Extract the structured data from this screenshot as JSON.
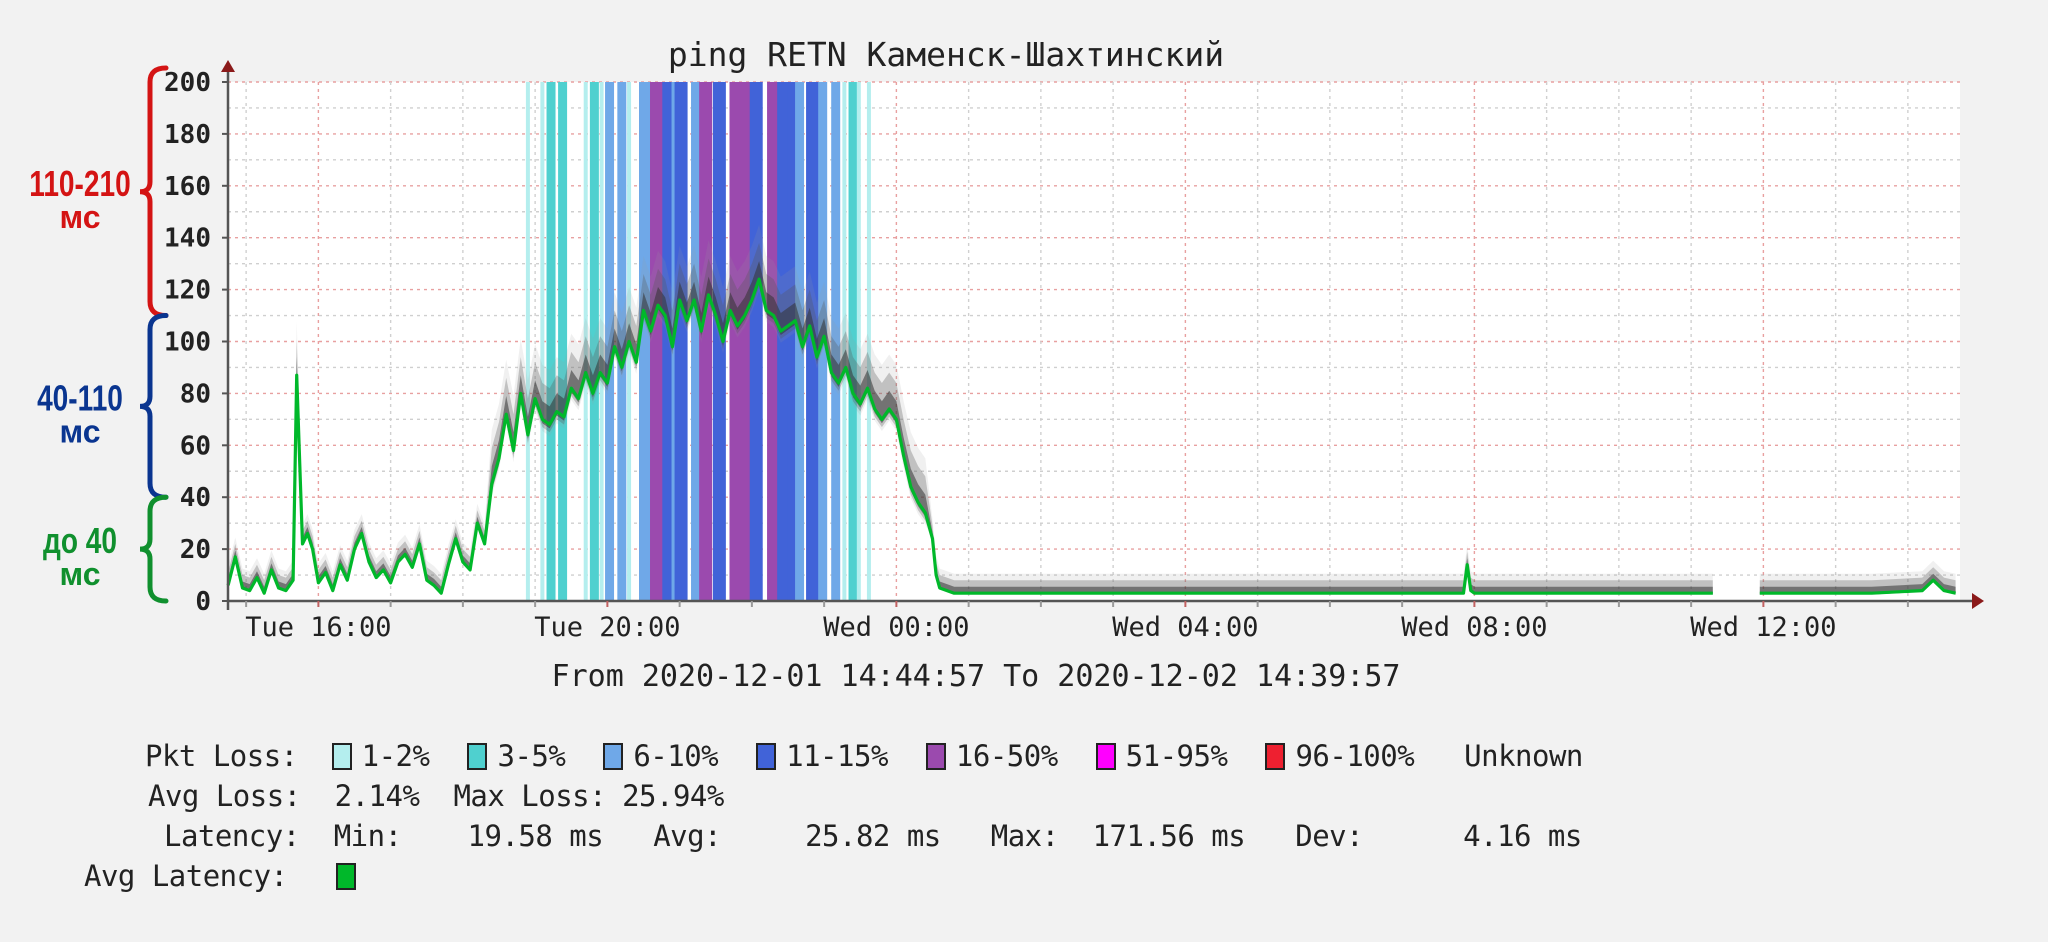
{
  "chart_data": {
    "type": "line",
    "title": "ping RETN Каменск-Шахтинский",
    "subtitle": "From 2020-12-01 14:44:57 To 2020-12-02 14:39:57",
    "xlabel": "",
    "ylabel": "",
    "ylim": [
      0,
      200
    ],
    "y_ticks": [
      "0",
      "20",
      "40",
      "60",
      "80",
      "100",
      "120",
      "140",
      "160",
      "180",
      "200"
    ],
    "x_range_hours": [
      14.749,
      38.666
    ],
    "x_ticks": [
      {
        "label": "Tue 16:00",
        "hour": 16
      },
      {
        "label": "Tue 20:00",
        "hour": 20
      },
      {
        "label": "Wed 00:00",
        "hour": 24
      },
      {
        "label": "Wed 04:00",
        "hour": 28
      },
      {
        "label": "Wed 08:00",
        "hour": 32
      },
      {
        "label": "Wed 12:00",
        "hour": 36
      }
    ],
    "grid": true,
    "series": [
      {
        "name": "Avg Latency",
        "color": "#00b82a",
        "unit": "ms",
        "points": [
          [
            14.75,
            6
          ],
          [
            14.85,
            17
          ],
          [
            14.95,
            5
          ],
          [
            15.05,
            4
          ],
          [
            15.15,
            9
          ],
          [
            15.25,
            3
          ],
          [
            15.35,
            12
          ],
          [
            15.45,
            5
          ],
          [
            15.55,
            4
          ],
          [
            15.65,
            8
          ],
          [
            15.7,
            87
          ],
          [
            15.78,
            22
          ],
          [
            15.85,
            26
          ],
          [
            15.92,
            20
          ],
          [
            16.0,
            7
          ],
          [
            16.1,
            11
          ],
          [
            16.2,
            4
          ],
          [
            16.3,
            14
          ],
          [
            16.4,
            8
          ],
          [
            16.5,
            20
          ],
          [
            16.6,
            26
          ],
          [
            16.7,
            15
          ],
          [
            16.8,
            9
          ],
          [
            16.9,
            12
          ],
          [
            17.0,
            7
          ],
          [
            17.1,
            15
          ],
          [
            17.2,
            18
          ],
          [
            17.3,
            13
          ],
          [
            17.4,
            22
          ],
          [
            17.5,
            8
          ],
          [
            17.6,
            6
          ],
          [
            17.7,
            3
          ],
          [
            17.8,
            14
          ],
          [
            17.9,
            24
          ],
          [
            18.0,
            15
          ],
          [
            18.1,
            12
          ],
          [
            18.2,
            30
          ],
          [
            18.3,
            22
          ],
          [
            18.4,
            45
          ],
          [
            18.5,
            55
          ],
          [
            18.6,
            72
          ],
          [
            18.7,
            58
          ],
          [
            18.8,
            80
          ],
          [
            18.9,
            64
          ],
          [
            19.0,
            78
          ],
          [
            19.1,
            70
          ],
          [
            19.2,
            68
          ],
          [
            19.3,
            73
          ],
          [
            19.4,
            71
          ],
          [
            19.5,
            82
          ],
          [
            19.6,
            78
          ],
          [
            19.7,
            88
          ],
          [
            19.8,
            80
          ],
          [
            19.9,
            88
          ],
          [
            20.0,
            84
          ],
          [
            20.1,
            98
          ],
          [
            20.2,
            90
          ],
          [
            20.3,
            100
          ],
          [
            20.4,
            92
          ],
          [
            20.5,
            112
          ],
          [
            20.6,
            104
          ],
          [
            20.7,
            114
          ],
          [
            20.8,
            110
          ],
          [
            20.9,
            98
          ],
          [
            21.0,
            116
          ],
          [
            21.1,
            108
          ],
          [
            21.2,
            116
          ],
          [
            21.3,
            104
          ],
          [
            21.4,
            118
          ],
          [
            21.5,
            110
          ],
          [
            21.6,
            100
          ],
          [
            21.7,
            112
          ],
          [
            21.8,
            106
          ],
          [
            21.9,
            110
          ],
          [
            22.0,
            116
          ],
          [
            22.1,
            124
          ],
          [
            22.2,
            112
          ],
          [
            22.3,
            110
          ],
          [
            22.4,
            104
          ],
          [
            22.5,
            106
          ],
          [
            22.6,
            108
          ],
          [
            22.7,
            98
          ],
          [
            22.8,
            106
          ],
          [
            22.9,
            94
          ],
          [
            23.0,
            102
          ],
          [
            23.1,
            88
          ],
          [
            23.2,
            84
          ],
          [
            23.3,
            90
          ],
          [
            23.4,
            80
          ],
          [
            23.5,
            76
          ],
          [
            23.6,
            82
          ],
          [
            23.7,
            74
          ],
          [
            23.8,
            70
          ],
          [
            23.9,
            74
          ],
          [
            24.0,
            70
          ],
          [
            24.1,
            56
          ],
          [
            24.2,
            44
          ],
          [
            24.3,
            38
          ],
          [
            24.4,
            34
          ],
          [
            24.5,
            24
          ],
          [
            24.55,
            10
          ],
          [
            24.6,
            5
          ],
          [
            24.8,
            3
          ],
          [
            25,
            3
          ],
          [
            26,
            3
          ],
          [
            27,
            3
          ],
          [
            28,
            3
          ],
          [
            29,
            3
          ],
          [
            30,
            3
          ],
          [
            31,
            3
          ],
          [
            31.85,
            3
          ],
          [
            31.9,
            14
          ],
          [
            31.95,
            4
          ],
          [
            32,
            3
          ],
          [
            33,
            3
          ],
          [
            34,
            3
          ],
          [
            35,
            3
          ],
          [
            35.3,
            3
          ],
          [
            35.95,
            3
          ],
          [
            36.4,
            3
          ],
          [
            37,
            3
          ],
          [
            37.5,
            3
          ],
          [
            38.2,
            4
          ],
          [
            38.35,
            8
          ],
          [
            38.5,
            4
          ],
          [
            38.66,
            3
          ]
        ],
        "gaps": [
          [
            35.3,
            35.95
          ]
        ]
      }
    ],
    "loss_bands": [
      {
        "hour": 18.9,
        "range": "1-2%"
      },
      {
        "hour": 19.1,
        "range": "1-2%"
      },
      {
        "hour": 19.22,
        "range": "3-5%"
      },
      {
        "hour": 19.38,
        "range": "3-5%"
      },
      {
        "hour": 19.7,
        "range": "1-2%"
      },
      {
        "hour": 19.82,
        "range": "3-5%"
      },
      {
        "hour": 19.92,
        "range": "1-2%"
      },
      {
        "hour": 20.03,
        "range": "6-10%"
      },
      {
        "hour": 20.2,
        "range": "6-10%"
      },
      {
        "hour": 20.3,
        "range": "1-2%"
      },
      {
        "hour": 20.5,
        "range": "6-10%"
      },
      {
        "hour": 20.58,
        "range": "6-10%"
      },
      {
        "hour": 20.68,
        "range": "16-50%"
      },
      {
        "hour": 20.85,
        "range": "11-15%"
      },
      {
        "hour": 20.95,
        "range": "6-10%"
      },
      {
        "hour": 21.02,
        "range": "11-15%"
      },
      {
        "hour": 21.22,
        "range": "6-10%"
      },
      {
        "hour": 21.36,
        "range": "16-50%"
      },
      {
        "hour": 21.55,
        "range": "11-15%"
      },
      {
        "hour": 21.78,
        "range": "16-50%"
      },
      {
        "hour": 21.95,
        "range": "16-50%"
      },
      {
        "hour": 22.06,
        "range": "11-15%"
      },
      {
        "hour": 22.3,
        "range": "16-50%"
      },
      {
        "hour": 22.44,
        "range": "11-15%"
      },
      {
        "hour": 22.58,
        "range": "11-15%"
      },
      {
        "hour": 22.66,
        "range": "6-10%"
      },
      {
        "hour": 22.84,
        "range": "11-15%"
      },
      {
        "hour": 22.98,
        "range": "6-10%"
      },
      {
        "hour": 23.16,
        "range": "6-10%"
      },
      {
        "hour": 23.28,
        "range": "1-2%"
      },
      {
        "hour": 23.4,
        "range": "3-5%"
      },
      {
        "hour": 23.48,
        "range": "1-2%"
      },
      {
        "hour": 23.62,
        "range": "1-2%"
      }
    ],
    "loss_band_widths": {
      "1-2%": "narrow",
      "3-5%": "medium",
      "6-10%": "medium",
      "11-15%": "wide",
      "16-50%": "wide"
    },
    "annotations": [
      {
        "label": "110-210",
        "unit": "мс",
        "range": [
          110,
          210
        ],
        "color": "#d41414"
      },
      {
        "label": "40-110",
        "unit": "мс",
        "range": [
          40,
          110
        ],
        "color": "#0a3590"
      },
      {
        "label": "до 40",
        "unit": "мс",
        "range": [
          0,
          40
        ],
        "color": "#10902e"
      }
    ]
  },
  "legend": {
    "pkt_loss_label": "Pkt Loss:",
    "pkt_loss_items": [
      {
        "label": "1-2%",
        "color": "#b4eeee"
      },
      {
        "label": "3-5%",
        "color": "#4fd0cf"
      },
      {
        "label": "6-10%",
        "color": "#6fa8e8"
      },
      {
        "label": "11-15%",
        "color": "#4163d8"
      },
      {
        "label": "16-50%",
        "color": "#9b4aae"
      },
      {
        "label": "51-95%",
        "color": "#ff00ff"
      },
      {
        "label": "96-100%",
        "color": "#ee2030"
      }
    ],
    "unknown_label": "Unknown",
    "avg_loss_label": "Avg Loss:",
    "avg_loss_value": "2.14%",
    "max_loss_label": "Max Loss:",
    "max_loss_value": "25.94%",
    "latency_label": "Latency:",
    "min_label": "Min:",
    "min_value": "19.58 ms",
    "avg_label": "Avg:",
    "avg_value": "25.82 ms",
    "max_label": "Max:",
    "max_value": "171.56 ms",
    "dev_label": "Dev:",
    "dev_value": "4.16 ms",
    "avg_latency_label": "Avg Latency:",
    "avg_latency_color": "#00b82a"
  }
}
